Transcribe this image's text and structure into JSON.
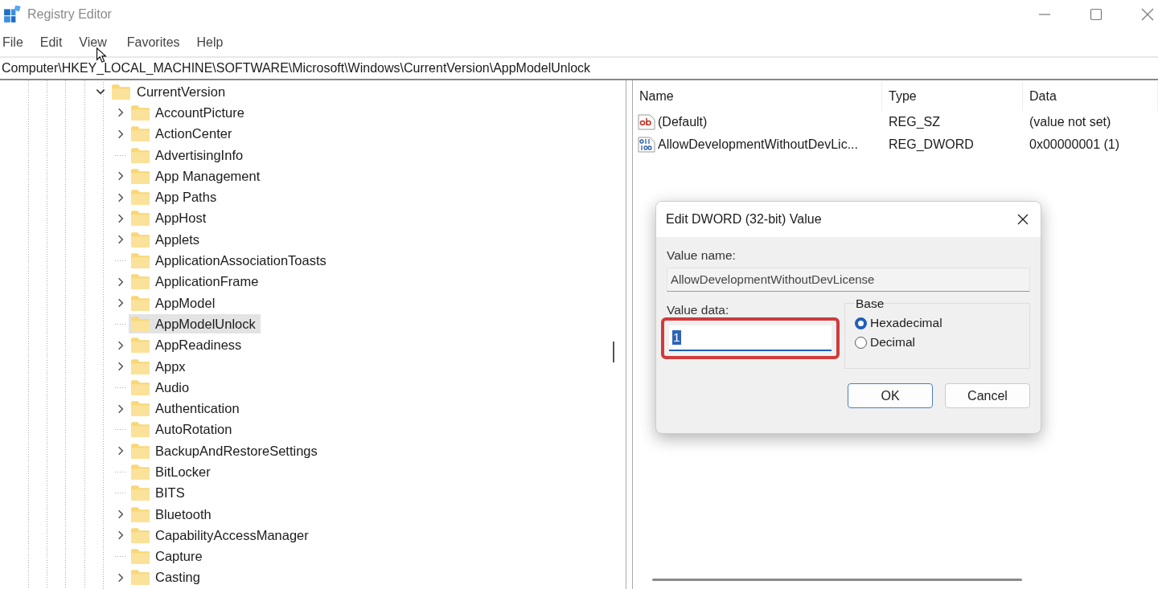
{
  "window": {
    "title": "Registry Editor"
  },
  "menu": [
    "File",
    "Edit",
    "View",
    "Favorites",
    "Help"
  ],
  "address": "Computer\\HKEY_LOCAL_MACHINE\\SOFTWARE\\Microsoft\\Windows\\CurrentVersion\\AppModelUnlock",
  "tree": {
    "label": "CurrentVersion",
    "expanded": true,
    "selected": false,
    "children": [
      {
        "label": "AccountPicture",
        "expandable": true,
        "selected": false
      },
      {
        "label": "ActionCenter",
        "expandable": true,
        "selected": false
      },
      {
        "label": "AdvertisingInfo",
        "expandable": false,
        "selected": false
      },
      {
        "label": "App Management",
        "expandable": true,
        "selected": false
      },
      {
        "label": "App Paths",
        "expandable": true,
        "selected": false
      },
      {
        "label": "AppHost",
        "expandable": true,
        "selected": false
      },
      {
        "label": "Applets",
        "expandable": true,
        "selected": false
      },
      {
        "label": "ApplicationAssociationToasts",
        "expandable": false,
        "selected": false
      },
      {
        "label": "ApplicationFrame",
        "expandable": true,
        "selected": false
      },
      {
        "label": "AppModel",
        "expandable": true,
        "selected": false
      },
      {
        "label": "AppModelUnlock",
        "expandable": false,
        "selected": true
      },
      {
        "label": "AppReadiness",
        "expandable": true,
        "selected": false
      },
      {
        "label": "Appx",
        "expandable": true,
        "selected": false
      },
      {
        "label": "Audio",
        "expandable": false,
        "selected": false
      },
      {
        "label": "Authentication",
        "expandable": true,
        "selected": false
      },
      {
        "label": "AutoRotation",
        "expandable": false,
        "selected": false
      },
      {
        "label": "BackupAndRestoreSettings",
        "expandable": true,
        "selected": false
      },
      {
        "label": "BitLocker",
        "expandable": false,
        "selected": false
      },
      {
        "label": "BITS",
        "expandable": false,
        "selected": false
      },
      {
        "label": "Bluetooth",
        "expandable": true,
        "selected": false
      },
      {
        "label": "CapabilityAccessManager",
        "expandable": true,
        "selected": false
      },
      {
        "label": "Capture",
        "expandable": false,
        "selected": false
      },
      {
        "label": "Casting",
        "expandable": true,
        "selected": false
      }
    ]
  },
  "values": {
    "columns": [
      "Name",
      "Type",
      "Data"
    ],
    "rows": [
      {
        "kind": "string",
        "name": "(Default)",
        "type": "REG_SZ",
        "data": "(value not set)"
      },
      {
        "kind": "dword",
        "name": "AllowDevelopmentWithoutDevLic...",
        "type": "REG_DWORD",
        "data": "0x00000001 (1)"
      }
    ]
  },
  "dialog": {
    "title": "Edit DWORD (32-bit) Value",
    "value_name_label": "Value name:",
    "value_name": "AllowDevelopmentWithoutDevLicense",
    "value_data_label": "Value data:",
    "value_data": "1",
    "value_data_selected": true,
    "value_data_highlighted": true,
    "base": {
      "label": "Base",
      "options": [
        {
          "label": "Hexadecimal",
          "selected": true
        },
        {
          "label": "Decimal",
          "selected": false
        }
      ]
    },
    "buttons": [
      {
        "label": "OK",
        "default": true
      },
      {
        "label": "Cancel",
        "default": false
      }
    ]
  }
}
